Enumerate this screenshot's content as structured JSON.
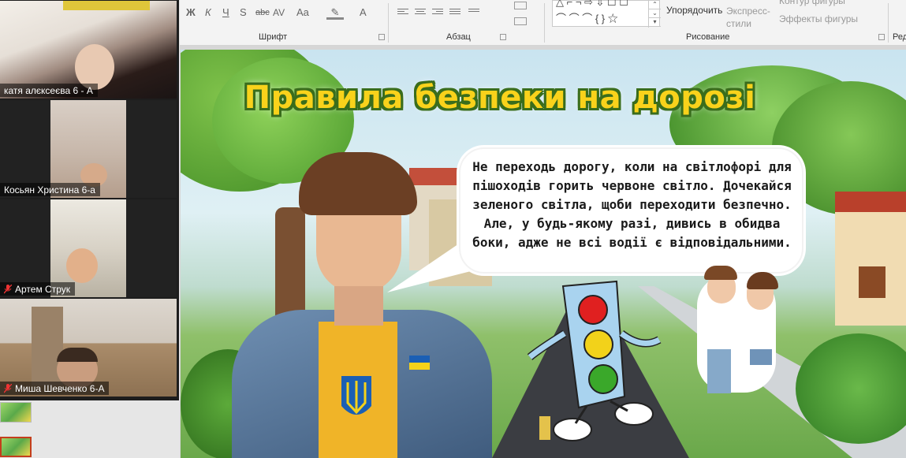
{
  "participants": [
    {
      "name": "катя алєксеєва 6 - А",
      "muted": false
    },
    {
      "name": "Косьян Христина 6-а",
      "muted": false
    },
    {
      "name": "Артем Струк",
      "muted": true
    },
    {
      "name": "Миша Шевченко 6-А",
      "muted": true
    }
  ],
  "ribbon": {
    "font_buttons": [
      "Ж",
      "К",
      "Ч",
      "S",
      "abc",
      "AV",
      "Aa",
      "A"
    ],
    "font_group": "Шрифт",
    "paragraph_group": "Абзац",
    "arrange_label": "Упорядочить",
    "quick_styles_label": "Экспресс-стили",
    "shape_outline_label": "Контур фигуры",
    "shape_effects_label": "Эффекты фигуры",
    "drawing_group": "Рисование",
    "editing_group_partial": "Ред"
  },
  "slide": {
    "title": "Правила безпеки на дорозі",
    "bubble_text": "Не переходь дорогу, коли на світлофорі для пішоходів горить червоне світло. Дочекайся зеленого світла, щоби переходити безпечно. Але, у будь-якому разі, дивись в обидва боки, адже не всі водії є відповідальними.",
    "flag_colors": [
      "#1b5fb4",
      "#f5d21a"
    ],
    "light_colors": [
      "#e02020",
      "#f2d21a",
      "#3aa82a"
    ]
  }
}
